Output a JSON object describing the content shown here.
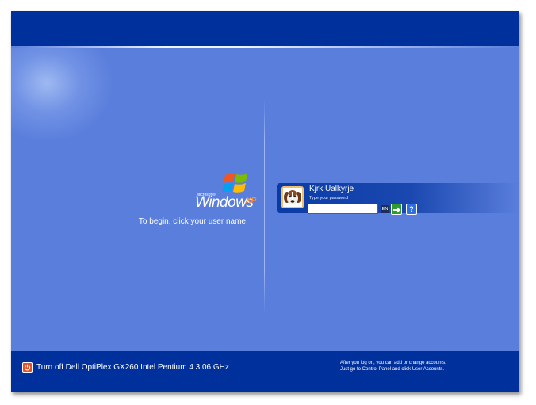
{
  "logo": {
    "brand_small": "Microsoft®",
    "product": "Windows",
    "edition": "XP"
  },
  "instruction": "To begin, click your user name",
  "user": {
    "name": "Kjrk Ualkyrje",
    "password_hint": "Type your password",
    "password_value": "",
    "language": "EN",
    "help_label": "?",
    "avatar_icon": "dog-avatar-icon"
  },
  "footer": {
    "turn_off_label": "Turn off Dell OptiPlex GX260 Intel Pentium 4 3.06 GHz",
    "account_note_line1": "After you log on, you can add or change accounts.",
    "account_note_line2": "Just go to Control Panel and click User Accounts."
  },
  "colors": {
    "top_bar": "#00309c",
    "main": "#5a7edc",
    "bottom_bar": "#00309c"
  }
}
